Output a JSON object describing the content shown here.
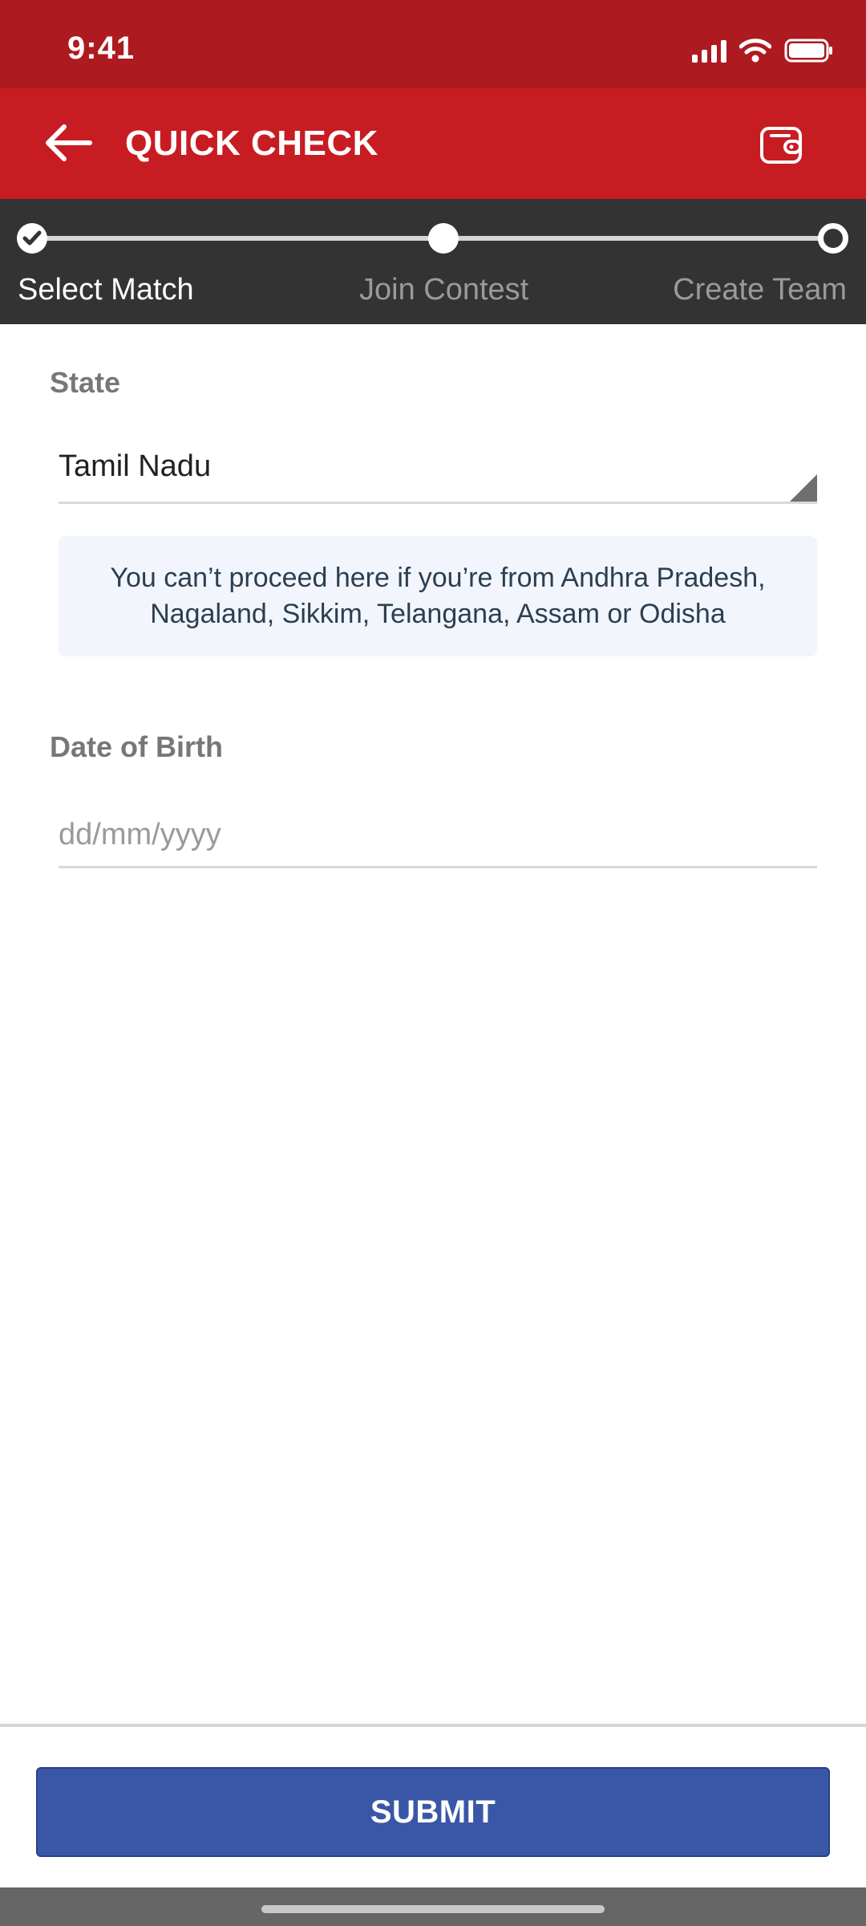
{
  "status_bar": {
    "time": "9:41",
    "icons": [
      "signal-icon",
      "wifi-icon",
      "battery-icon"
    ]
  },
  "header": {
    "title": "QUICK CHECK",
    "back_icon": "arrow-left-icon",
    "wallet_icon": "wallet-icon"
  },
  "stepper": {
    "steps": [
      {
        "label": "Select Match",
        "state": "completed"
      },
      {
        "label": "Join Contest",
        "state": "current"
      },
      {
        "label": "Create Team",
        "state": "upcoming"
      }
    ]
  },
  "form": {
    "state_label": "State",
    "state_value": "Tamil Nadu",
    "notice": "You can’t proceed here if you’re from Andhra Pradesh, Nagaland, Sikkim, Telangana, Assam or Odisha",
    "dob_label": "Date of Birth",
    "dob_value": "",
    "dob_placeholder": "dd/mm/yyyy"
  },
  "footer": {
    "submit_label": "SUBMIT"
  },
  "colors": {
    "status_bar": "#ad1a20",
    "header": "#c81c23",
    "stepper": "#333333",
    "notice_bg": "#f2f6fc",
    "submit": "#3a57a7"
  }
}
